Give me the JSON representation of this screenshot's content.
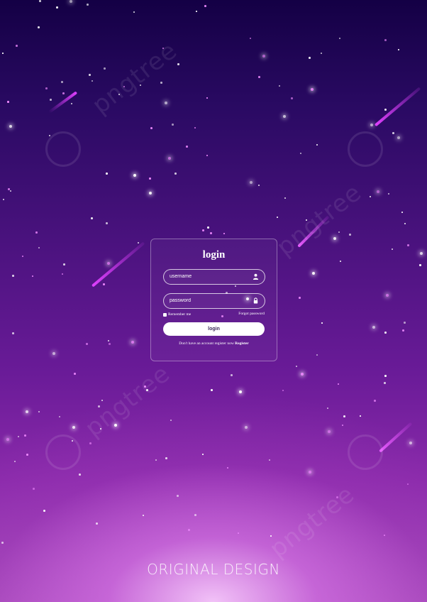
{
  "login_form": {
    "title": "login",
    "username_placeholder": "username",
    "password_placeholder": "password",
    "remember_label": "Remember me",
    "forgot_label": "Forgot password",
    "button_label": "login",
    "register_prompt": "Don't have an account register now",
    "register_link": "Register"
  },
  "footer": {
    "text": "ORIGINAL DESIGN"
  },
  "watermark": {
    "text": "pngtree"
  },
  "colors": {
    "sky_top": "#140045",
    "sky_bottom": "#a448b8",
    "glow": "#f5c8fa",
    "meteor": "#e040ff",
    "button_text": "#3b2a5a"
  },
  "icons": {
    "username_field": "user-icon",
    "password_field": "lock-icon"
  }
}
